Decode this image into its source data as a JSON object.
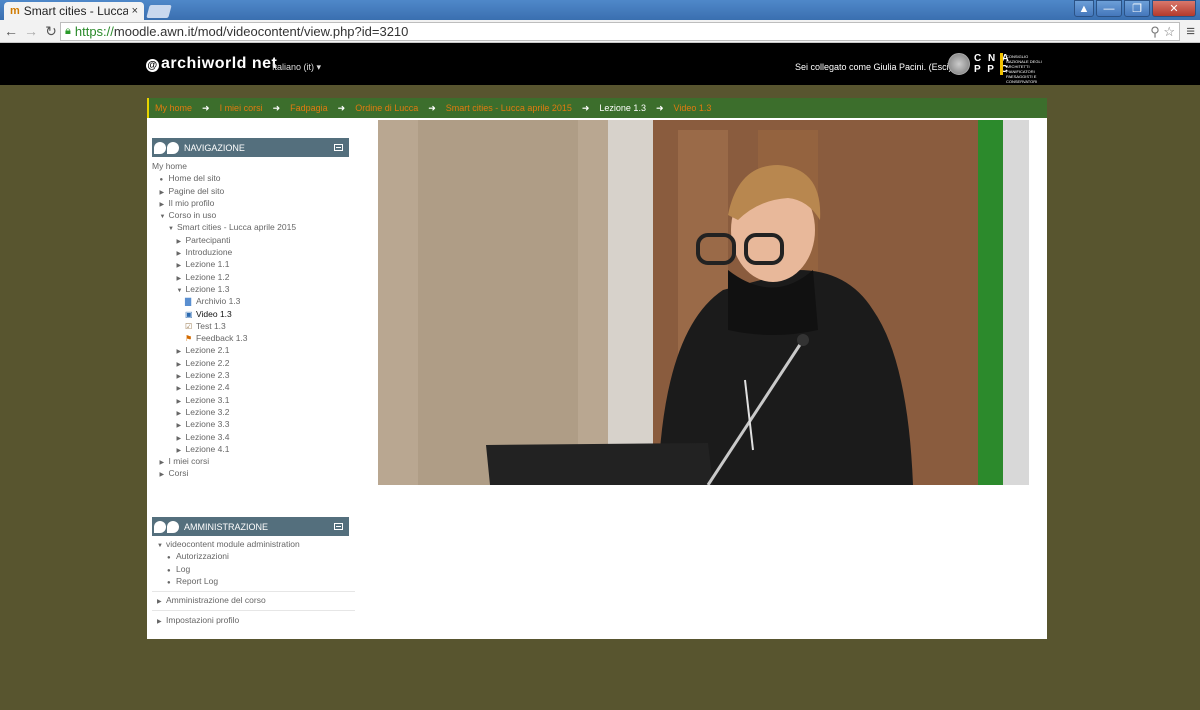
{
  "browser": {
    "tab_title": "Smart cities - Lucca a",
    "tab_favicon": "m",
    "tab_close": "×",
    "url_secure": "https://",
    "url_rest": "moodle.awn.it/mod/videocontent/view.php?id=3210",
    "window_buttons": [
      "▲",
      "—",
      "❐",
      "✕"
    ]
  },
  "header": {
    "logo_text": "archiworld net",
    "language": "Italiano (it) ▾",
    "logged_in": "Sei collegato come Giulia Pacini. (Esci)",
    "cna_line1": "C N A",
    "cna_line2": "P P C",
    "cna_subtitle": "CONSIGLIO NAZIONALE DEGLI ARCHITETTI PIANIFICATORI PAESAGGISTI E CONSERVATORI"
  },
  "breadcrumb": [
    {
      "label": "My home",
      "current": false
    },
    {
      "label": "I miei corsi",
      "current": false
    },
    {
      "label": "Fadpagia",
      "current": false
    },
    {
      "label": "Ordine di Lucca",
      "current": false
    },
    {
      "label": "Smart cities - Lucca aprile 2015",
      "current": false
    },
    {
      "label": "Lezione 1.3",
      "current": true
    },
    {
      "label": "Video 1.3",
      "current": false
    }
  ],
  "navigation": {
    "title": "NAVIGAZIONE",
    "items": [
      {
        "label": "My home",
        "level": 0,
        "marker": ""
      },
      {
        "label": "Home del sito",
        "level": 1,
        "marker": "●"
      },
      {
        "label": "Pagine del sito",
        "level": 1,
        "marker": "▶"
      },
      {
        "label": "Il mio profilo",
        "level": 1,
        "marker": "▶"
      },
      {
        "label": "Corso in uso",
        "level": 1,
        "marker": "▼"
      },
      {
        "label": "Smart cities - Lucca aprile 2015",
        "level": 2,
        "marker": "▼"
      },
      {
        "label": "Partecipanti",
        "level": 3,
        "marker": "▶"
      },
      {
        "label": "Introduzione",
        "level": 3,
        "marker": "▶"
      },
      {
        "label": "Lezione 1.1",
        "level": 3,
        "marker": "▶"
      },
      {
        "label": "Lezione 1.2",
        "level": 3,
        "marker": "▶"
      },
      {
        "label": "Lezione 1.3",
        "level": 3,
        "marker": "▼"
      },
      {
        "label": "Archivio 1.3",
        "level": 4,
        "marker": "",
        "icon": "folder-icon"
      },
      {
        "label": "Video 1.3",
        "level": 4,
        "marker": "",
        "icon": "video-icon",
        "bold": true
      },
      {
        "label": "Test 1.3",
        "level": 4,
        "marker": "",
        "icon": "quiz-icon"
      },
      {
        "label": "Feedback 1.3",
        "level": 4,
        "marker": "",
        "icon": "feedback-icon"
      },
      {
        "label": "Lezione 2.1",
        "level": 3,
        "marker": "▶"
      },
      {
        "label": "Lezione 2.2",
        "level": 3,
        "marker": "▶"
      },
      {
        "label": "Lezione 2.3",
        "level": 3,
        "marker": "▶"
      },
      {
        "label": "Lezione 2.4",
        "level": 3,
        "marker": "▶"
      },
      {
        "label": "Lezione 3.1",
        "level": 3,
        "marker": "▶"
      },
      {
        "label": "Lezione 3.2",
        "level": 3,
        "marker": "▶"
      },
      {
        "label": "Lezione 3.3",
        "level": 3,
        "marker": "▶"
      },
      {
        "label": "Lezione 3.4",
        "level": 3,
        "marker": "▶"
      },
      {
        "label": "Lezione 4.1",
        "level": 3,
        "marker": "▶"
      },
      {
        "label": "I miei corsi",
        "level": 1,
        "marker": "▶"
      },
      {
        "label": "Corsi",
        "level": 1,
        "marker": "▶"
      }
    ]
  },
  "administration": {
    "title": "AMMINISTRAZIONE",
    "module_admin": "videocontent module administration",
    "module_items": [
      "Autorizzazioni",
      "Log",
      "Report Log"
    ],
    "course_admin": "Amministrazione del corso",
    "profile_settings": "Impostazioni profilo"
  },
  "colors": {
    "page_background": "#58552f",
    "breadcrumb_bar": "#3c6e2c",
    "breadcrumb_link": "#e07a10",
    "block_header": "#546f7d"
  }
}
